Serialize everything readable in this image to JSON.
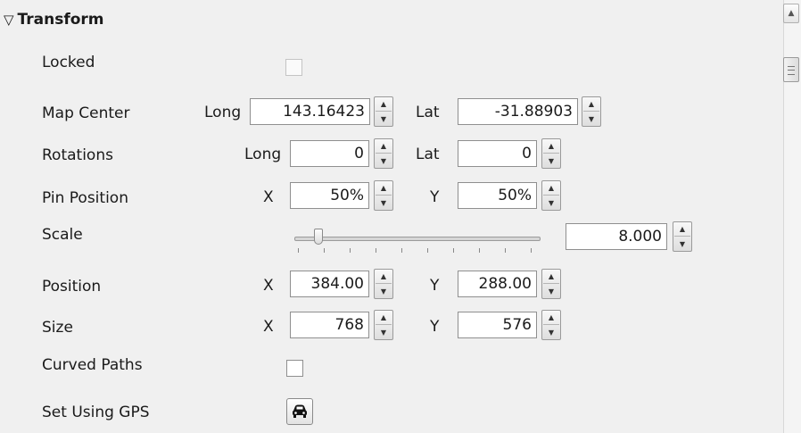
{
  "section": {
    "title": "Transform",
    "icon": "collapse-triangle-icon"
  },
  "rows": {
    "locked": {
      "label": "Locked",
      "checked": false
    },
    "map_center": {
      "label": "Map Center",
      "long_label": "Long",
      "long_value": "143.16423",
      "lat_label": "Lat",
      "lat_value": "-31.88903"
    },
    "rotations": {
      "label": "Rotations",
      "long_label": "Long",
      "long_value": "0",
      "lat_label": "Lat",
      "lat_value": "0"
    },
    "pin_position": {
      "label": "Pin Position",
      "x_label": "X",
      "x_value": "50%",
      "y_label": "Y",
      "y_value": "50%"
    },
    "scale": {
      "label": "Scale",
      "value": "8.000",
      "slider_fraction": 0.09
    },
    "position": {
      "label": "Position",
      "x_label": "X",
      "x_value": "384.00",
      "y_label": "Y",
      "y_value": "288.00"
    },
    "size": {
      "label": "Size",
      "x_label": "X",
      "x_value": "768",
      "y_label": "Y",
      "y_value": "576"
    },
    "curved_paths": {
      "label": "Curved Paths",
      "checked": false
    },
    "set_using_gps": {
      "label": "Set Using GPS",
      "icon": "gps-car-icon"
    }
  },
  "scrollbar": {
    "up_icon": "scroll-up-arrow-icon",
    "thumb_icon": "scroll-thumb-grip-icon"
  }
}
